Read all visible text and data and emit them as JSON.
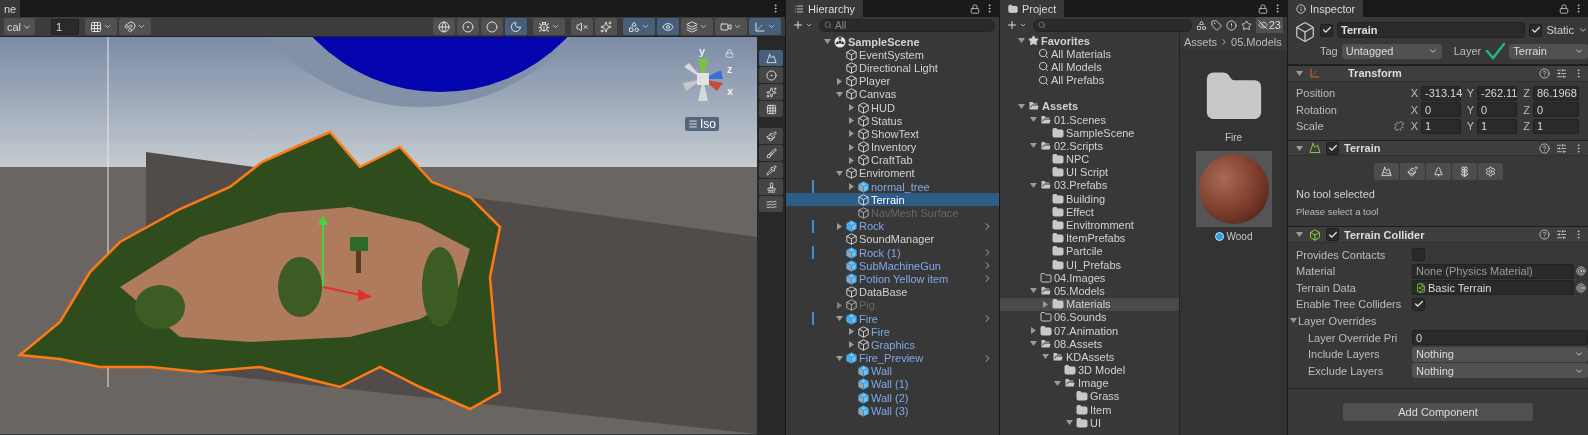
{
  "scene": {
    "tab": "ne",
    "pivot_mode": "cal",
    "snap_value": "1",
    "snap_tools": [
      {
        "dropdown": true
      },
      {
        "dropdown": true
      }
    ],
    "view_tools": [
      {
        "selected": false,
        "dropdown": false
      },
      {
        "selected": false,
        "dropdown": false
      },
      {
        "selected": false,
        "dropdown": false
      },
      {
        "selected": true,
        "dropdown": false
      },
      {
        "selected": false,
        "dropdown": true
      },
      {
        "selected": false,
        "dropdown": false
      },
      {
        "selected": false,
        "dropdown": false
      },
      {
        "selected": true,
        "dropdown": true
      },
      {
        "selected": true,
        "dropdown": false
      },
      {
        "selected": false,
        "dropdown": true
      },
      {
        "selected": false,
        "dropdown": true
      },
      {
        "selected": true,
        "dropdown": true
      }
    ],
    "gizmo": {
      "y_label": "y",
      "z_label": "z",
      "x_label": "x",
      "projection": "Iso"
    },
    "terrain_tools": [
      {
        "selected": true
      },
      {
        "selected": false
      },
      {
        "selected": false
      },
      {
        "selected": false
      }
    ],
    "brush_tools": [
      {
        "selected": false
      },
      {
        "selected": false
      },
      {
        "selected": false
      },
      {
        "selected": false
      },
      {
        "selected": false
      }
    ]
  },
  "hierarchy": {
    "title": "Hierarchy",
    "search_placeholder": "All",
    "items": [
      {
        "label": "SampleScene",
        "kind": "scene",
        "selected": false,
        "inactive": false,
        "overridden": false,
        "open_button": false,
        "expanded": true,
        "children": [
          {
            "label": "EventSystem",
            "kind": "object",
            "selected": false,
            "inactive": false,
            "overridden": false,
            "open_button": false
          },
          {
            "label": "Directional Light",
            "kind": "object",
            "selected": false,
            "inactive": false,
            "overridden": false,
            "open_button": false
          },
          {
            "label": "Player",
            "kind": "object",
            "selected": false,
            "inactive": false,
            "overridden": false,
            "open_button": false,
            "expanded": false
          },
          {
            "label": "Canvas",
            "kind": "object",
            "selected": false,
            "inactive": false,
            "overridden": false,
            "open_button": false,
            "expanded": true,
            "children": [
              {
                "label": "HUD",
                "kind": "object",
                "selected": false,
                "inactive": false,
                "overridden": false,
                "open_button": false,
                "expanded": false
              },
              {
                "label": "Status",
                "kind": "object",
                "selected": false,
                "inactive": false,
                "overridden": false,
                "open_button": false,
                "expanded": false
              },
              {
                "label": "ShowText",
                "kind": "object",
                "selected": false,
                "inactive": false,
                "overridden": false,
                "open_button": false,
                "expanded": false
              },
              {
                "label": "Inventory",
                "kind": "object",
                "selected": false,
                "inactive": false,
                "overridden": false,
                "open_button": false,
                "expanded": false
              },
              {
                "label": "CraftTab",
                "kind": "object",
                "selected": false,
                "inactive": false,
                "overridden": false,
                "open_button": false,
                "expanded": false
              }
            ]
          },
          {
            "label": "Enviroment",
            "kind": "object",
            "selected": false,
            "inactive": false,
            "overridden": false,
            "open_button": false,
            "expanded": true,
            "children": [
              {
                "label": "normal_tree",
                "kind": "model_prefab",
                "selected": false,
                "inactive": false,
                "overridden": true,
                "open_button": false,
                "expanded": false
              },
              {
                "label": "Terrain",
                "kind": "object",
                "selected": true,
                "inactive": false,
                "overridden": false,
                "open_button": false
              },
              {
                "label": "NavMesh Surface",
                "kind": "object",
                "selected": false,
                "inactive": true,
                "overridden": false,
                "open_button": false
              }
            ]
          },
          {
            "label": "Rock",
            "kind": "prefab",
            "selected": false,
            "inactive": false,
            "overridden": true,
            "open_button": true,
            "expanded": false
          },
          {
            "label": "SoundManager",
            "kind": "object",
            "selected": false,
            "inactive": false,
            "overridden": false,
            "open_button": false
          },
          {
            "label": "Rock (1)",
            "kind": "model_prefab",
            "selected": false,
            "inactive": false,
            "overridden": true,
            "open_button": true
          },
          {
            "label": "SubMachineGun",
            "kind": "model_prefab",
            "selected": false,
            "inactive": false,
            "overridden": false,
            "open_button": true
          },
          {
            "label": "Potion Yellow item",
            "kind": "model_prefab",
            "selected": false,
            "inactive": false,
            "overridden": false,
            "open_button": true
          },
          {
            "label": "DataBase",
            "kind": "object",
            "selected": false,
            "inactive": false,
            "overridden": false,
            "open_button": false
          },
          {
            "label": "Pig",
            "kind": "object",
            "selected": false,
            "inactive": true,
            "overridden": false,
            "open_button": false,
            "expanded": false
          },
          {
            "label": "Fire",
            "kind": "prefab",
            "selected": false,
            "inactive": false,
            "overridden": true,
            "open_button": true,
            "expanded": true,
            "children": [
              {
                "label": "Fire",
                "kind": "prefab_child",
                "selected": false,
                "inactive": false,
                "overridden": false,
                "open_button": false,
                "expanded": false
              },
              {
                "label": "Graphics",
                "kind": "prefab_child",
                "selected": false,
                "inactive": false,
                "overridden": false,
                "open_button": false,
                "expanded": false
              }
            ]
          },
          {
            "label": "Fire_Preview",
            "kind": "prefab",
            "selected": false,
            "inactive": false,
            "overridden": false,
            "open_button": true,
            "expanded": true,
            "children": [
              {
                "label": "Wall",
                "kind": "model_prefab",
                "selected": false,
                "inactive": false,
                "overridden": false,
                "open_button": false
              },
              {
                "label": "Wall (1)",
                "kind": "model_prefab",
                "selected": false,
                "inactive": false,
                "overridden": false,
                "open_button": false
              },
              {
                "label": "Wall (2)",
                "kind": "model_prefab",
                "selected": false,
                "inactive": false,
                "overridden": false,
                "open_button": false
              },
              {
                "label": "Wall (3)",
                "kind": "model_prefab",
                "selected": false,
                "inactive": false,
                "overridden": false,
                "open_button": false
              }
            ]
          }
        ]
      }
    ]
  },
  "project": {
    "title": "Project",
    "hidden_count": "23",
    "favorites": {
      "label": "Favorites",
      "expanded": true,
      "items": [
        {
          "label": "All Materials"
        },
        {
          "label": "All Models"
        },
        {
          "label": "All Prefabs"
        }
      ]
    },
    "assets": {
      "label": "Assets",
      "kind": "folder",
      "selected": false,
      "expanded": true,
      "children": [
        {
          "label": "01.Scenes",
          "kind": "folder",
          "selected": false,
          "expanded": true,
          "children": [
            {
              "label": "SampleScene",
              "kind": "folder",
              "selected": false
            }
          ]
        },
        {
          "label": "02.Scripts",
          "kind": "folder",
          "selected": false,
          "expanded": true,
          "children": [
            {
              "label": "NPC",
              "kind": "folder",
              "selected": false
            },
            {
              "label": "UI Script",
              "kind": "folder",
              "selected": false
            }
          ]
        },
        {
          "label": "03.Prefabs",
          "kind": "folder",
          "selected": false,
          "expanded": true,
          "children": [
            {
              "label": "Building",
              "kind": "folder",
              "selected": false
            },
            {
              "label": "Effect",
              "kind": "folder",
              "selected": false
            },
            {
              "label": "Envitromment",
              "kind": "folder",
              "selected": false
            },
            {
              "label": "ItemPrefabs",
              "kind": "folder",
              "selected": false
            },
            {
              "label": "Partcile",
              "kind": "folder",
              "selected": false
            },
            {
              "label": "UI_Prefabs",
              "kind": "folder",
              "selected": false
            }
          ]
        },
        {
          "label": "04.Images",
          "kind": "empty_folder",
          "selected": false
        },
        {
          "label": "05.Models",
          "kind": "folder",
          "selected": false,
          "expanded": true,
          "children": [
            {
              "label": "Materials",
              "kind": "folder",
              "selected": true,
              "expanded": false
            }
          ]
        },
        {
          "label": "06.Sounds",
          "kind": "empty_folder",
          "selected": false
        },
        {
          "label": "07.Animation",
          "kind": "folder",
          "selected": false,
          "expanded": false
        },
        {
          "label": "08.Assets",
          "kind": "folder",
          "selected": false,
          "expanded": true,
          "children": [
            {
              "label": "KDAssets",
              "kind": "folder",
              "selected": false,
              "expanded": true,
              "children": [
                {
                  "label": "3D Model",
                  "kind": "folder",
                  "selected": false
                },
                {
                  "label": "Image",
                  "kind": "folder",
                  "selected": false,
                  "expanded": true,
                  "children": [
                    {
                      "label": "Grass",
                      "kind": "folder",
                      "selected": false
                    },
                    {
                      "label": "Item",
                      "kind": "folder",
                      "selected": false
                    },
                    {
                      "label": "UI",
                      "kind": "folder",
                      "selected": false,
                      "expanded": true
                    }
                  ]
                }
              ]
            }
          ]
        }
      ]
    },
    "breadcrumb": [
      "Assets",
      "05.Models"
    ],
    "grid": [
      {
        "label": "Fire",
        "kind": "folder"
      },
      {
        "label": "Wood",
        "kind": "material"
      }
    ]
  },
  "inspector": {
    "title": "Inspector",
    "object": {
      "active": true,
      "name": "Terrain",
      "static": true,
      "static_label": "Static",
      "tag_label": "Tag",
      "tag": "Untagged",
      "layer_label": "Layer",
      "layer": "Terrain"
    },
    "components": [
      {
        "kind": "transform",
        "title": "Transform",
        "expanded": true,
        "rows": [
          {
            "label": "Position",
            "linked": false,
            "values": [
              {
                "axis": "X",
                "value": "-313.14"
              },
              {
                "axis": "Y",
                "value": "-262.11"
              },
              {
                "axis": "Z",
                "value": "86.1968"
              }
            ]
          },
          {
            "label": "Rotation",
            "linked": false,
            "values": [
              {
                "axis": "X",
                "value": "0"
              },
              {
                "axis": "Y",
                "value": "0"
              },
              {
                "axis": "Z",
                "value": "0"
              }
            ]
          },
          {
            "label": "Scale",
            "linked": true,
            "values": [
              {
                "axis": "X",
                "value": "1"
              },
              {
                "axis": "Y",
                "value": "1"
              },
              {
                "axis": "Z",
                "value": "1"
              }
            ]
          }
        ]
      },
      {
        "kind": "terrain",
        "title": "Terrain",
        "enabled": true,
        "expanded": true,
        "tools": [
          {
            "selected": false
          },
          {
            "selected": false
          },
          {
            "selected": false
          },
          {
            "selected": false
          },
          {
            "selected": false
          }
        ],
        "message": "No tool selected",
        "hint": "Please select a tool"
      },
      {
        "kind": "terrain_collider",
        "title": "Terrain Collider",
        "enabled": true,
        "expanded": true,
        "properties": [
          {
            "kind": "checkbox",
            "label": "Provides Contacts",
            "checked": false
          },
          {
            "kind": "object",
            "label": "Material",
            "value": "None (Physics Material)",
            "has_icon": false
          },
          {
            "kind": "object",
            "label": "Terrain Data",
            "value": "Basic Terrain",
            "has_icon": true
          },
          {
            "kind": "checkbox",
            "label": "Enable Tree Colliders",
            "checked": true
          },
          {
            "kind": "foldout",
            "label": "Layer Overrides",
            "expanded": true,
            "children": [
              {
                "kind": "number",
                "label": "Layer Override Pri",
                "value": "0"
              },
              {
                "kind": "dropdown",
                "label": "Include Layers",
                "value": "Nothing"
              },
              {
                "kind": "dropdown",
                "label": "Exclude Layers",
                "value": "Nothing"
              }
            ]
          }
        ]
      }
    ],
    "add_button": "Add Component"
  }
}
